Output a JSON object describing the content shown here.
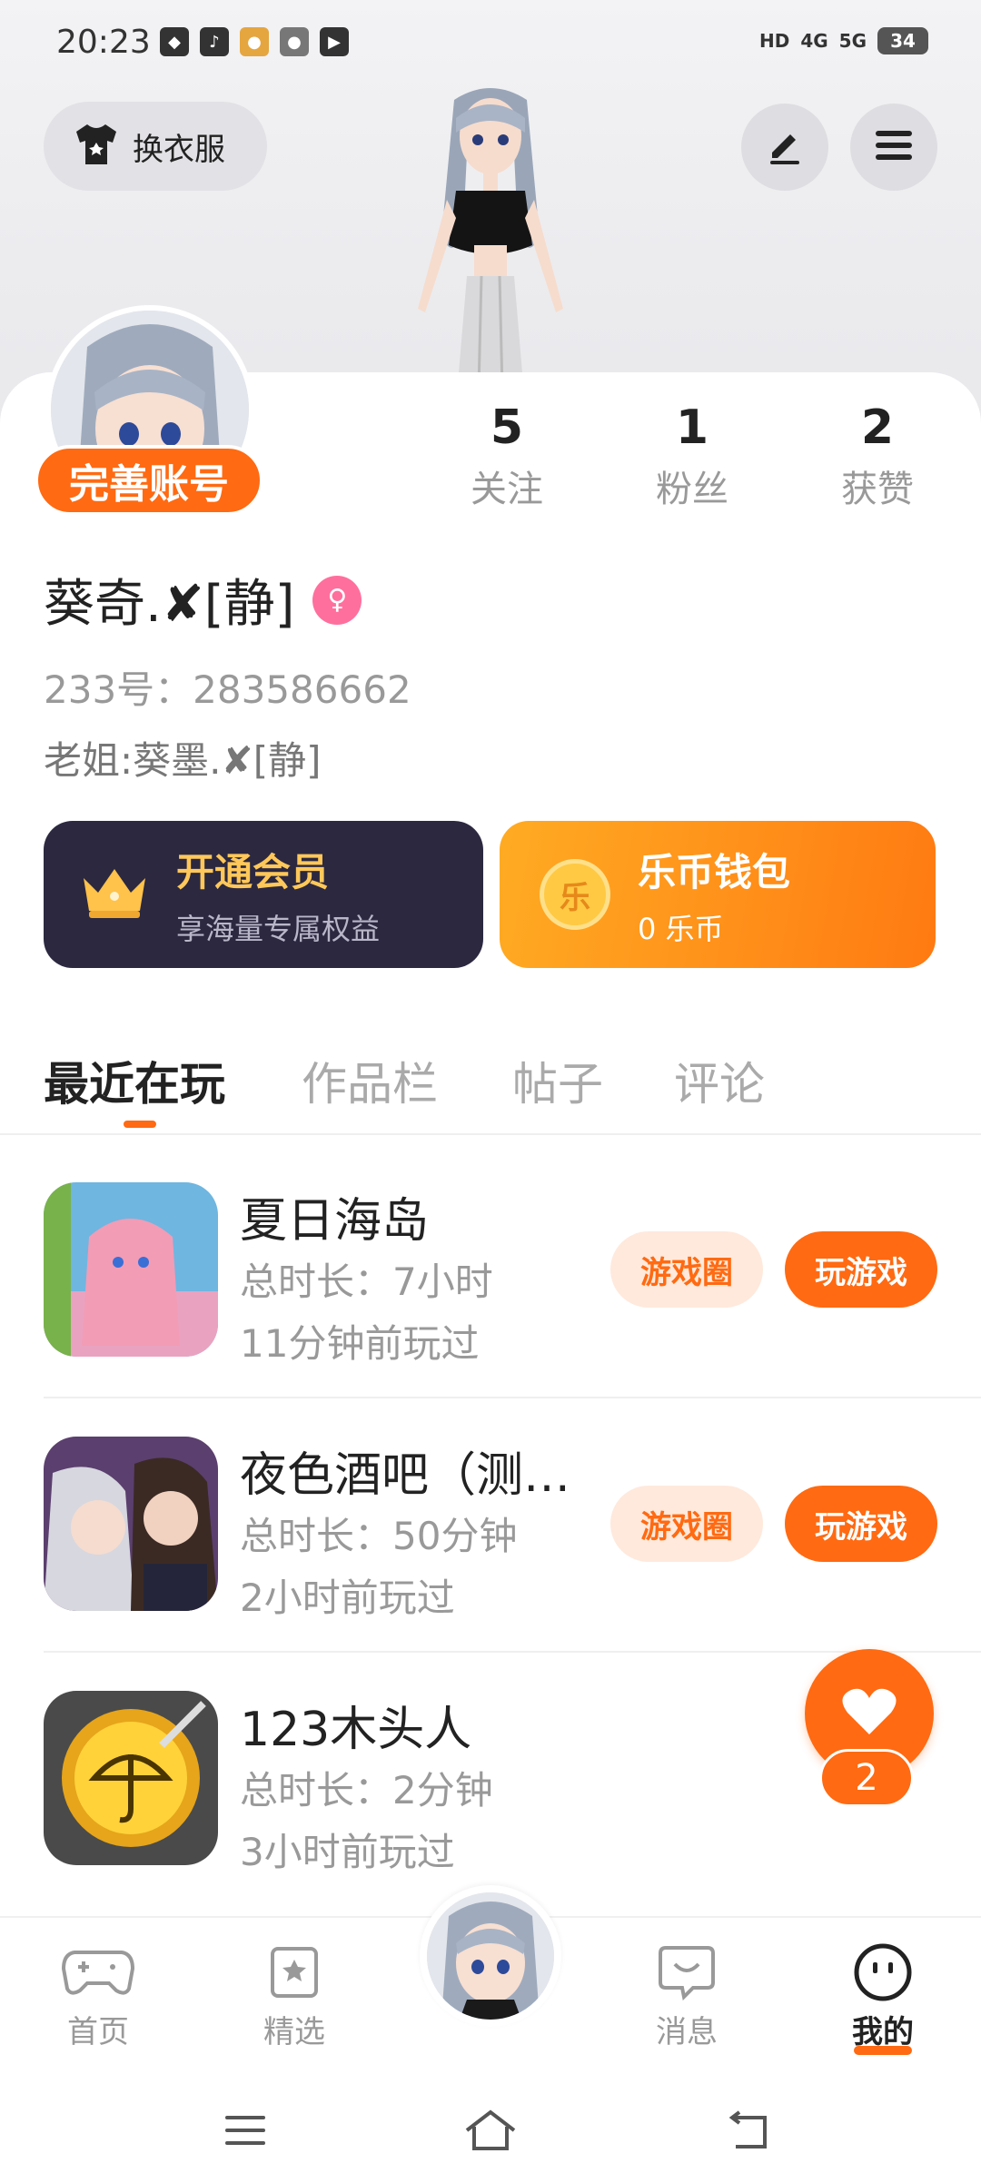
{
  "status_bar": {
    "time": "20:23",
    "network_1": "HD",
    "network_2": "4G",
    "network_3": "5G",
    "battery": "34"
  },
  "header": {
    "outfit_button": "换衣服"
  },
  "profile": {
    "complete_account": "完善账号",
    "stats": [
      {
        "num": "5",
        "label": "关注"
      },
      {
        "num": "1",
        "label": "粉丝"
      },
      {
        "num": "2",
        "label": "获赞"
      }
    ],
    "nickname": "葵奇.✘[静]",
    "uid": "233号：283586662",
    "bio": "老姐:葵墨.✘[静]"
  },
  "cards": {
    "vip_title": "开通会员",
    "vip_sub": "享海量专属权益",
    "wallet_title": "乐币钱包",
    "wallet_sub": "0 乐币",
    "wallet_coin": "乐"
  },
  "tabs": [
    {
      "label": "最近在玩"
    },
    {
      "label": "作品栏"
    },
    {
      "label": "帖子"
    },
    {
      "label": "评论"
    }
  ],
  "games": [
    {
      "name": "夏日海岛",
      "duration": "总时长：7小时",
      "last": "11分钟前玩过",
      "circle": "游戏圈",
      "play": "玩游戏"
    },
    {
      "name": "夜色酒吧（测…",
      "duration": "总时长：50分钟",
      "last": "2小时前玩过",
      "circle": "游戏圈",
      "play": "玩游戏"
    },
    {
      "name": "123木头人",
      "duration": "总时长：2分钟",
      "last": "3小时前玩过"
    }
  ],
  "fab": {
    "count": "2"
  },
  "bottom_nav": [
    {
      "label": "首页"
    },
    {
      "label": "精选"
    },
    {
      "label": "消息"
    },
    {
      "label": "我的"
    }
  ],
  "colors": {
    "accent": "#ff6a12",
    "vip_bg": "#2b2840",
    "gold": "#ffc85a"
  }
}
